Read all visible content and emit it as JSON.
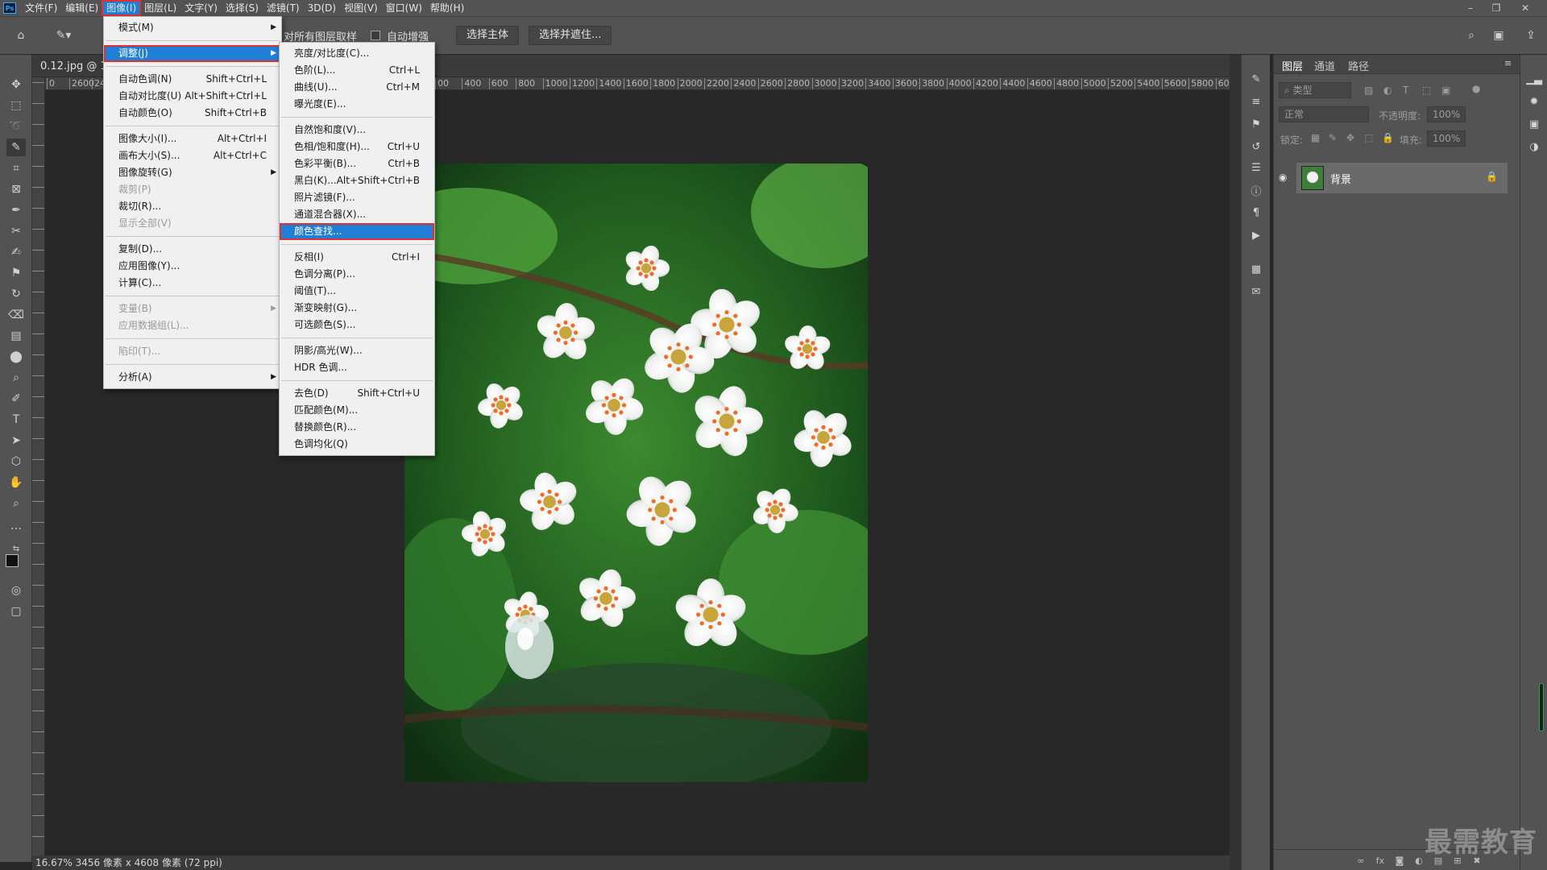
{
  "menubar": {
    "logo": "Ps",
    "items": [
      "文件(F)",
      "编辑(E)",
      "图像(I)",
      "图层(L)",
      "文字(Y)",
      "选择(S)",
      "滤镜(T)",
      "3D(D)",
      "视图(V)",
      "窗口(W)",
      "帮助(H)"
    ],
    "active_index": 2
  },
  "optionsbar": {
    "sample_all_layers": "对所有图层取样",
    "auto_enhance": "自动增强",
    "select_subject": "选择主体",
    "select_and_mask": "选择并遮住..."
  },
  "document": {
    "tab_title": "0.12.jpg @ 16",
    "ruler_h_left": [
      "0",
      "2600",
      "240"
    ],
    "ruler_h_right": [
      "00",
      "400",
      "600",
      "800",
      "1000",
      "1200",
      "1400",
      "1600",
      "1800",
      "2000",
      "2200",
      "2400",
      "2600",
      "2800",
      "3000",
      "3200",
      "3400",
      "3600",
      "3800",
      "4000",
      "4200",
      "4400",
      "4600",
      "4800",
      "5000",
      "5200",
      "5400",
      "5600",
      "5800",
      "60"
    ],
    "status": "16.67%   3456 像素 x 4608 像素 (72 ppi)"
  },
  "image_menu": {
    "items": [
      {
        "label": "模式(M)",
        "shortcut": "",
        "submenu": true,
        "disabled": false,
        "sep_after": true
      },
      {
        "label": "调整(J)",
        "shortcut": "",
        "submenu": true,
        "disabled": false,
        "highlight": true,
        "sep_after": true
      },
      {
        "label": "自动色调(N)",
        "shortcut": "Shift+Ctrl+L",
        "submenu": false,
        "disabled": false
      },
      {
        "label": "自动对比度(U)",
        "shortcut": "Alt+Shift+Ctrl+L",
        "submenu": false,
        "disabled": false
      },
      {
        "label": "自动颜色(O)",
        "shortcut": "Shift+Ctrl+B",
        "submenu": false,
        "disabled": false,
        "sep_after": true
      },
      {
        "label": "图像大小(I)...",
        "shortcut": "Alt+Ctrl+I",
        "submenu": false,
        "disabled": false
      },
      {
        "label": "画布大小(S)...",
        "shortcut": "Alt+Ctrl+C",
        "submenu": false,
        "disabled": false
      },
      {
        "label": "图像旋转(G)",
        "shortcut": "",
        "submenu": true,
        "disabled": false
      },
      {
        "label": "裁剪(P)",
        "shortcut": "",
        "submenu": false,
        "disabled": true
      },
      {
        "label": "裁切(R)...",
        "shortcut": "",
        "submenu": false,
        "disabled": false
      },
      {
        "label": "显示全部(V)",
        "shortcut": "",
        "submenu": false,
        "disabled": true,
        "sep_after": true
      },
      {
        "label": "复制(D)...",
        "shortcut": "",
        "submenu": false,
        "disabled": false
      },
      {
        "label": "应用图像(Y)...",
        "shortcut": "",
        "submenu": false,
        "disabled": false
      },
      {
        "label": "计算(C)...",
        "shortcut": "",
        "submenu": false,
        "disabled": false,
        "sep_after": true
      },
      {
        "label": "变量(B)",
        "shortcut": "",
        "submenu": true,
        "disabled": true
      },
      {
        "label": "应用数据组(L)...",
        "shortcut": "",
        "submenu": false,
        "disabled": true,
        "sep_after": true
      },
      {
        "label": "陷印(T)...",
        "shortcut": "",
        "submenu": false,
        "disabled": true,
        "sep_after": true
      },
      {
        "label": "分析(A)",
        "shortcut": "",
        "submenu": true,
        "disabled": false
      }
    ]
  },
  "adjust_menu": {
    "items": [
      {
        "label": "亮度/对比度(C)...",
        "shortcut": ""
      },
      {
        "label": "色阶(L)...",
        "shortcut": "Ctrl+L"
      },
      {
        "label": "曲线(U)...",
        "shortcut": "Ctrl+M"
      },
      {
        "label": "曝光度(E)...",
        "shortcut": "",
        "sep_after": true
      },
      {
        "label": "自然饱和度(V)...",
        "shortcut": ""
      },
      {
        "label": "色相/饱和度(H)...",
        "shortcut": "Ctrl+U"
      },
      {
        "label": "色彩平衡(B)...",
        "shortcut": "Ctrl+B"
      },
      {
        "label": "黑白(K)...",
        "shortcut": "Alt+Shift+Ctrl+B"
      },
      {
        "label": "照片滤镜(F)...",
        "shortcut": ""
      },
      {
        "label": "通道混合器(X)...",
        "shortcut": ""
      },
      {
        "label": "颜色查找...",
        "shortcut": "",
        "highlight": true,
        "sep_after": true
      },
      {
        "label": "反相(I)",
        "shortcut": "Ctrl+I"
      },
      {
        "label": "色调分离(P)...",
        "shortcut": ""
      },
      {
        "label": "阈值(T)...",
        "shortcut": ""
      },
      {
        "label": "渐变映射(G)...",
        "shortcut": ""
      },
      {
        "label": "可选颜色(S)...",
        "shortcut": "",
        "sep_after": true
      },
      {
        "label": "阴影/高光(W)...",
        "shortcut": ""
      },
      {
        "label": "HDR 色调...",
        "shortcut": "",
        "sep_after": true
      },
      {
        "label": "去色(D)",
        "shortcut": "Shift+Ctrl+U"
      },
      {
        "label": "匹配颜色(M)...",
        "shortcut": ""
      },
      {
        "label": "替换颜色(R)...",
        "shortcut": ""
      },
      {
        "label": "色调均化(Q)",
        "shortcut": ""
      }
    ]
  },
  "layers_panel": {
    "tabs": [
      "图层",
      "通道",
      "路径"
    ],
    "filter_placeholder": "类型",
    "blend_mode": "正常",
    "opacity_label": "不透明度:",
    "opacity_value": "100%",
    "lock_label": "锁定:",
    "fill_label": "填充:",
    "fill_value": "100%",
    "layer_name": "背景"
  },
  "watermark": "最需教育",
  "colors": {
    "accent": "#1f7fd6",
    "highlight_outline": "#e03030",
    "panel_bg": "#535353",
    "canvas_bg": "#282828"
  }
}
